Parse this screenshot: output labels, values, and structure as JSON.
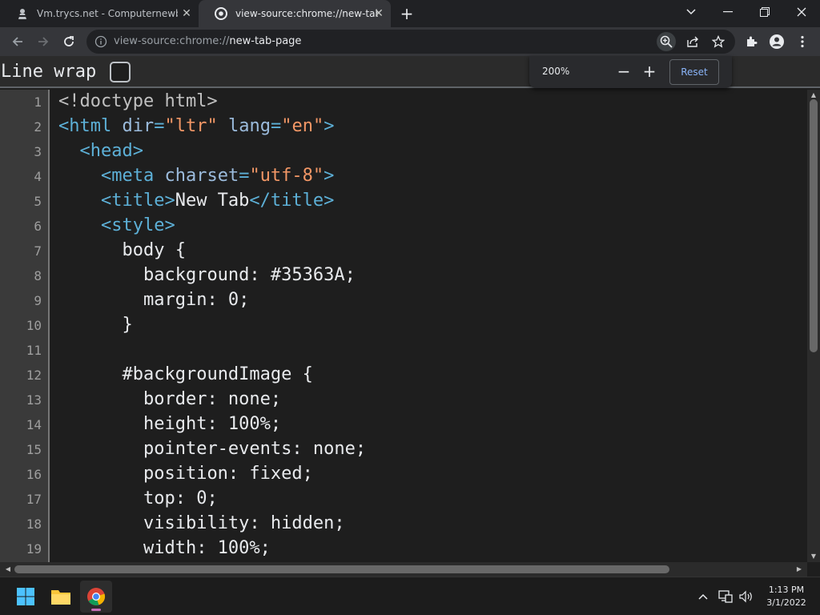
{
  "tabs": [
    {
      "title": "Vm.trycs.net - Computernewb W",
      "icon": "computernewb-favicon",
      "active": false
    },
    {
      "title": "view-source:chrome://new-tab-p",
      "icon": "chrome-favicon",
      "active": true
    }
  ],
  "omnibox": {
    "url_prefix": "view-source:chrome://",
    "url_host": "new-tab-page"
  },
  "zoom": {
    "level": "200%",
    "minus": "−",
    "plus": "+",
    "reset_label": "Reset"
  },
  "line_wrap": {
    "label": "Line wrap",
    "checked": false
  },
  "code_lines": [
    {
      "n": "1",
      "indent": "",
      "parts": [
        [
          "doc",
          "<!doctype html>"
        ]
      ]
    },
    {
      "n": "2",
      "indent": "",
      "parts": [
        [
          "tag",
          "<html "
        ],
        [
          "attr",
          "dir"
        ],
        [
          "tag",
          "="
        ],
        [
          "val",
          "\"ltr\""
        ],
        [
          "tag",
          " "
        ],
        [
          "attr",
          "lang"
        ],
        [
          "tag",
          "="
        ],
        [
          "val",
          "\"en\""
        ],
        [
          "tag",
          ">"
        ]
      ]
    },
    {
      "n": "3",
      "indent": "  ",
      "parts": [
        [
          "tag",
          "<head>"
        ]
      ]
    },
    {
      "n": "4",
      "indent": "    ",
      "parts": [
        [
          "tag",
          "<meta "
        ],
        [
          "attr",
          "charset"
        ],
        [
          "tag",
          "="
        ],
        [
          "val",
          "\"utf-8\""
        ],
        [
          "tag",
          ">"
        ]
      ]
    },
    {
      "n": "5",
      "indent": "    ",
      "parts": [
        [
          "tag",
          "<title>"
        ],
        [
          "txt",
          "New Tab"
        ],
        [
          "tag",
          "</title>"
        ]
      ]
    },
    {
      "n": "6",
      "indent": "    ",
      "parts": [
        [
          "tag",
          "<style>"
        ]
      ]
    },
    {
      "n": "7",
      "indent": "      ",
      "parts": [
        [
          "txt",
          "body {"
        ]
      ]
    },
    {
      "n": "8",
      "indent": "        ",
      "parts": [
        [
          "txt",
          "background: #35363A;"
        ]
      ]
    },
    {
      "n": "9",
      "indent": "        ",
      "parts": [
        [
          "txt",
          "margin: 0;"
        ]
      ]
    },
    {
      "n": "10",
      "indent": "      ",
      "parts": [
        [
          "txt",
          "}"
        ]
      ]
    },
    {
      "n": "11",
      "indent": "",
      "parts": [
        [
          "txt",
          ""
        ]
      ]
    },
    {
      "n": "12",
      "indent": "      ",
      "parts": [
        [
          "txt",
          "#backgroundImage {"
        ]
      ]
    },
    {
      "n": "13",
      "indent": "        ",
      "parts": [
        [
          "txt",
          "border: none;"
        ]
      ]
    },
    {
      "n": "14",
      "indent": "        ",
      "parts": [
        [
          "txt",
          "height: 100%;"
        ]
      ]
    },
    {
      "n": "15",
      "indent": "        ",
      "parts": [
        [
          "txt",
          "pointer-events: none;"
        ]
      ]
    },
    {
      "n": "16",
      "indent": "        ",
      "parts": [
        [
          "txt",
          "position: fixed;"
        ]
      ]
    },
    {
      "n": "17",
      "indent": "        ",
      "parts": [
        [
          "txt",
          "top: 0;"
        ]
      ]
    },
    {
      "n": "18",
      "indent": "        ",
      "parts": [
        [
          "txt",
          "visibility: hidden;"
        ]
      ]
    },
    {
      "n": "19",
      "indent": "        ",
      "parts": [
        [
          "txt",
          "width: 100%;"
        ]
      ]
    }
  ],
  "taskbar": {
    "apps": [
      "windows-start",
      "file-explorer",
      "google-chrome"
    ],
    "time": "1:13 PM",
    "date": "3/1/2022"
  },
  "colors": {
    "tag": "#5db0d7",
    "attr": "#9bbbdc",
    "value": "#f29766",
    "background": "#1e1e1e"
  }
}
